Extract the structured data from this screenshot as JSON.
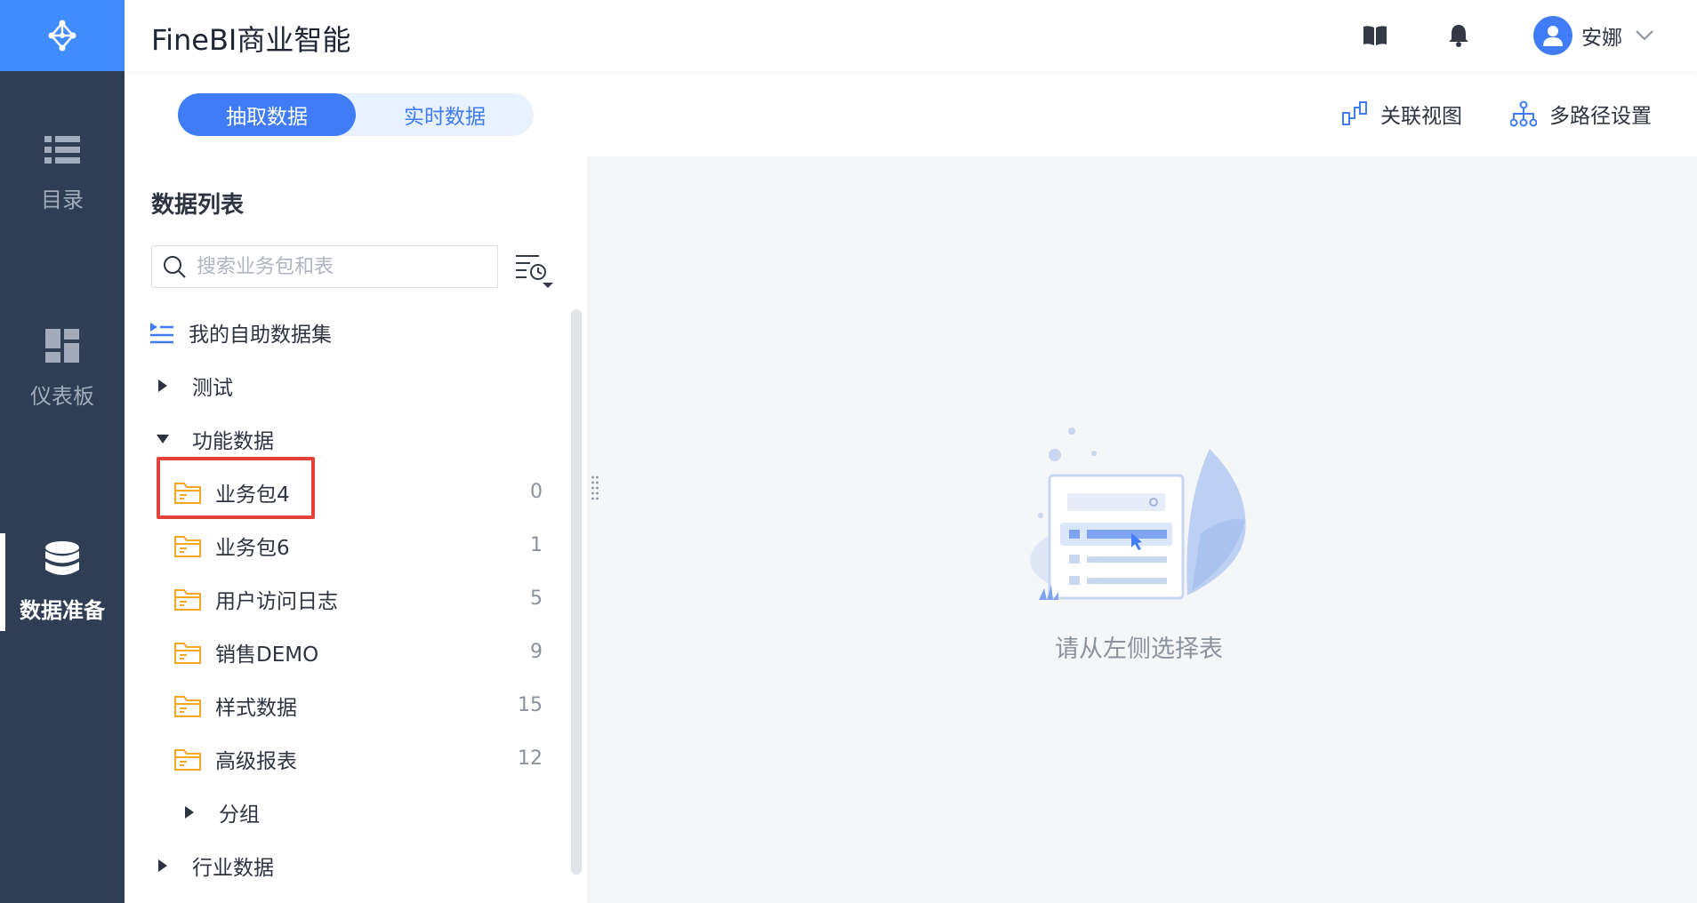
{
  "app": {
    "title": "FineBI商业智能"
  },
  "nav": {
    "items": [
      {
        "label": "目录",
        "icon": "list-icon"
      },
      {
        "label": "仪表板",
        "icon": "dashboard-icon"
      },
      {
        "label": "数据准备",
        "icon": "database-icon",
        "active": true
      }
    ]
  },
  "header": {
    "user_name": "安娜",
    "icons": [
      "book-icon",
      "bell-icon",
      "user-avatar-icon",
      "chevron-down-icon"
    ]
  },
  "mode_tabs": [
    {
      "label": "抽取数据",
      "active": true
    },
    {
      "label": "实时数据",
      "active": false
    }
  ],
  "toolbar": {
    "relation_view": "关联视图",
    "multipath_settings": "多路径设置"
  },
  "data_list": {
    "title": "数据列表",
    "search_placeholder": "搜索业务包和表",
    "self_dataset": "我的自助数据集",
    "groups": [
      {
        "label": "测试",
        "expanded": false
      },
      {
        "label": "功能数据",
        "expanded": true
      },
      {
        "label": "行业数据",
        "expanded": false
      }
    ],
    "packages": [
      {
        "label": "业务包4",
        "count": "0",
        "highlighted": true
      },
      {
        "label": "业务包6",
        "count": "1"
      },
      {
        "label": "用户访问日志",
        "count": "5"
      },
      {
        "label": "销售DEMO",
        "count": "9"
      },
      {
        "label": "样式数据",
        "count": "15"
      },
      {
        "label": "高级报表",
        "count": "12"
      }
    ],
    "subgroup": "分组"
  },
  "empty_state": {
    "message": "请从左侧选择表"
  },
  "colors": {
    "accent": "#3f7cf5",
    "nav_bg": "#2f3e55",
    "logo_bg": "#3f8cff",
    "folder": "#f5a623",
    "highlight_border": "#e2413c"
  }
}
